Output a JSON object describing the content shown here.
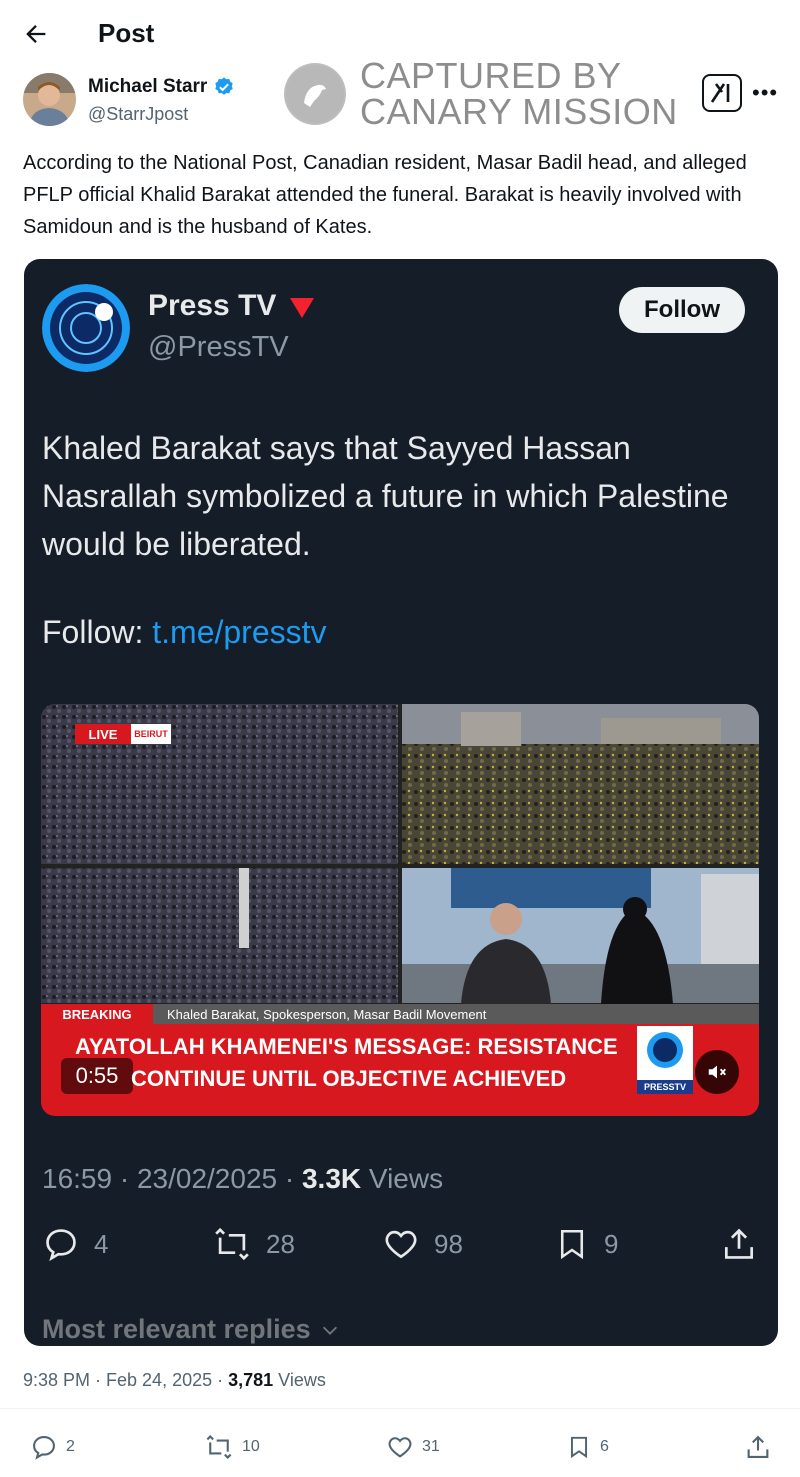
{
  "header": {
    "title": "Post",
    "back_icon": "arrow-left-icon"
  },
  "author": {
    "name": "Michael Starr",
    "handle": "@StarrJpost",
    "verified_color": "#1d9bf0"
  },
  "watermark": {
    "line1": "CAPTURED BY",
    "line2": "CANARY MISSION"
  },
  "post": {
    "text": "According to the National Post, Canadian resident, Masar Badil head, and alleged PFLP official Khalid Barakat attended the funeral. Barakat is heavily involved with Samidoun and is the husband of Kates."
  },
  "embed": {
    "name": "Press TV",
    "handle": "@PressTV",
    "follow_label": "Follow",
    "text": "Khaled Barakat says that Sayyed Hassan Nasrallah symbolized a future in which Palestine would be liberated.",
    "follow_prefix": "Follow: ",
    "link": "t.me/presstv",
    "video": {
      "live_label": "LIVE",
      "location": "BEIRUT",
      "breaking_label": "BREAKING",
      "caption": "Khaled Barakat, Spokesperson, Masar Badil Movement",
      "headline_line1": "AYATOLLAH KHAMENEI'S MESSAGE: RESISTANCE",
      "headline_line2": "CONTINUE UNTIL OBJECTIVE ACHIEVED",
      "duration": "0:55",
      "logo_text": "PRESSTV"
    },
    "time": "16:59 · 23/02/2025 · ",
    "views_count": "3.3K",
    "views_label": " Views",
    "replies": "4",
    "reposts": "28",
    "likes": "98",
    "bookmarks": "9",
    "most_relevant": "Most relevant replies"
  },
  "footer": {
    "time": "9:38 PM · Feb 24, 2025 · ",
    "views_count": "3,781",
    "views_label": " Views",
    "replies": "2",
    "reposts": "10",
    "likes": "31",
    "bookmarks": "6"
  },
  "colors": {
    "accent": "#1d9bf0",
    "dark_card": "#151d28",
    "breaking_red": "#d7191f"
  }
}
